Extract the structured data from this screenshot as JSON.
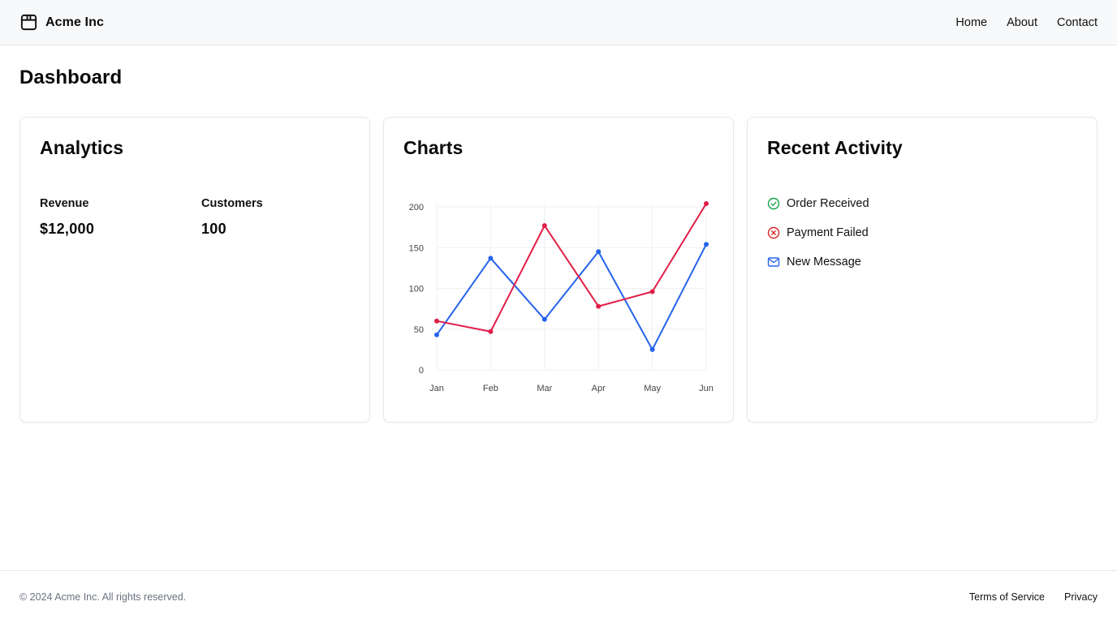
{
  "header": {
    "brand": "Acme Inc",
    "brand_icon": "package-icon",
    "nav": [
      {
        "label": "Home"
      },
      {
        "label": "About"
      },
      {
        "label": "Contact"
      }
    ]
  },
  "page": {
    "title": "Dashboard"
  },
  "analytics": {
    "title": "Analytics",
    "metrics": [
      {
        "label": "Revenue",
        "value": "$12,000"
      },
      {
        "label": "Customers",
        "value": "100"
      }
    ]
  },
  "charts": {
    "title": "Charts"
  },
  "chart_data": {
    "type": "line",
    "categories": [
      "Jan",
      "Feb",
      "Mar",
      "Apr",
      "May",
      "Jun"
    ],
    "yticks": [
      "0",
      "50",
      "100",
      "150",
      "200"
    ],
    "ylim": [
      0,
      200
    ],
    "grid": true,
    "legend": "none",
    "series": [
      {
        "color": "#2563eb",
        "values": [
          43,
          137,
          62,
          145,
          25,
          154
        ]
      },
      {
        "color": "#e11d48",
        "values": [
          60,
          47,
          177,
          78,
          96,
          204
        ]
      }
    ]
  },
  "activity": {
    "title": "Recent Activity",
    "items": [
      {
        "label": "Order Received",
        "icon": "check-circle-icon",
        "color": "#16a34a"
      },
      {
        "label": "Payment Failed",
        "icon": "x-circle-icon",
        "color": "#dc2626"
      },
      {
        "label": "New Message",
        "icon": "mail-icon",
        "color": "#2563eb"
      }
    ]
  },
  "footer": {
    "copyright": "© 2024 Acme Inc. All rights reserved.",
    "links": [
      {
        "label": "Terms of Service"
      },
      {
        "label": "Privacy"
      }
    ]
  }
}
